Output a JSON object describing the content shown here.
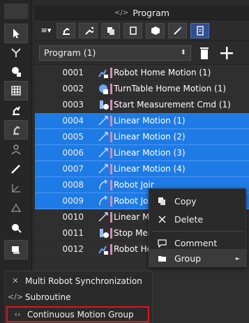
{
  "panel": {
    "title": "Program",
    "program_select": "Program (1)"
  },
  "rows": [
    {
      "num": "0001",
      "label": "Robot Home Motion (1)",
      "icon": "robot-home-icon",
      "selected": false
    },
    {
      "num": "0002",
      "label": "TurnTable Home Motion (1)",
      "icon": "turntable-icon",
      "selected": false
    },
    {
      "num": "0003",
      "label": "Start Measurement Cmd (1)",
      "icon": "measurement-icon",
      "selected": false
    },
    {
      "num": "0004",
      "label": "Linear Motion (1)",
      "icon": "linear-motion-icon",
      "selected": true
    },
    {
      "num": "0005",
      "label": "Linear Motion (2)",
      "icon": "linear-motion-icon",
      "selected": true
    },
    {
      "num": "0006",
      "label": "Linear Motion (3)",
      "icon": "linear-motion-icon",
      "selected": true
    },
    {
      "num": "0007",
      "label": "Linear Motion (4)",
      "icon": "linear-motion-icon",
      "selected": true
    },
    {
      "num": "0008",
      "label": "Robot Joir",
      "icon": "joint-motion-icon",
      "selected": true
    },
    {
      "num": "0009",
      "label": "Robot Joir",
      "icon": "joint-motion-icon",
      "selected": true
    },
    {
      "num": "0010",
      "label": "Linear Mc",
      "icon": "linear-motion-icon",
      "selected": false
    },
    {
      "num": "0011",
      "label": "Stop Mea",
      "icon": "measurement-icon",
      "selected": false
    },
    {
      "num": "0012",
      "label": "Robot Ho",
      "icon": "robot-home-icon",
      "selected": false
    }
  ],
  "context_menu": {
    "copy": "Copy",
    "delete": "Delete",
    "comment": "Comment",
    "group": "Group"
  },
  "submenu": {
    "multi_robot": "Multi Robot Synchronization",
    "subroutine": "Subroutine",
    "continuous": "Continuous Motion Group"
  },
  "colors": {
    "selection": "#1e7be6",
    "highlight_box": "#e0141e",
    "pink_marker": "#d98bb4"
  }
}
